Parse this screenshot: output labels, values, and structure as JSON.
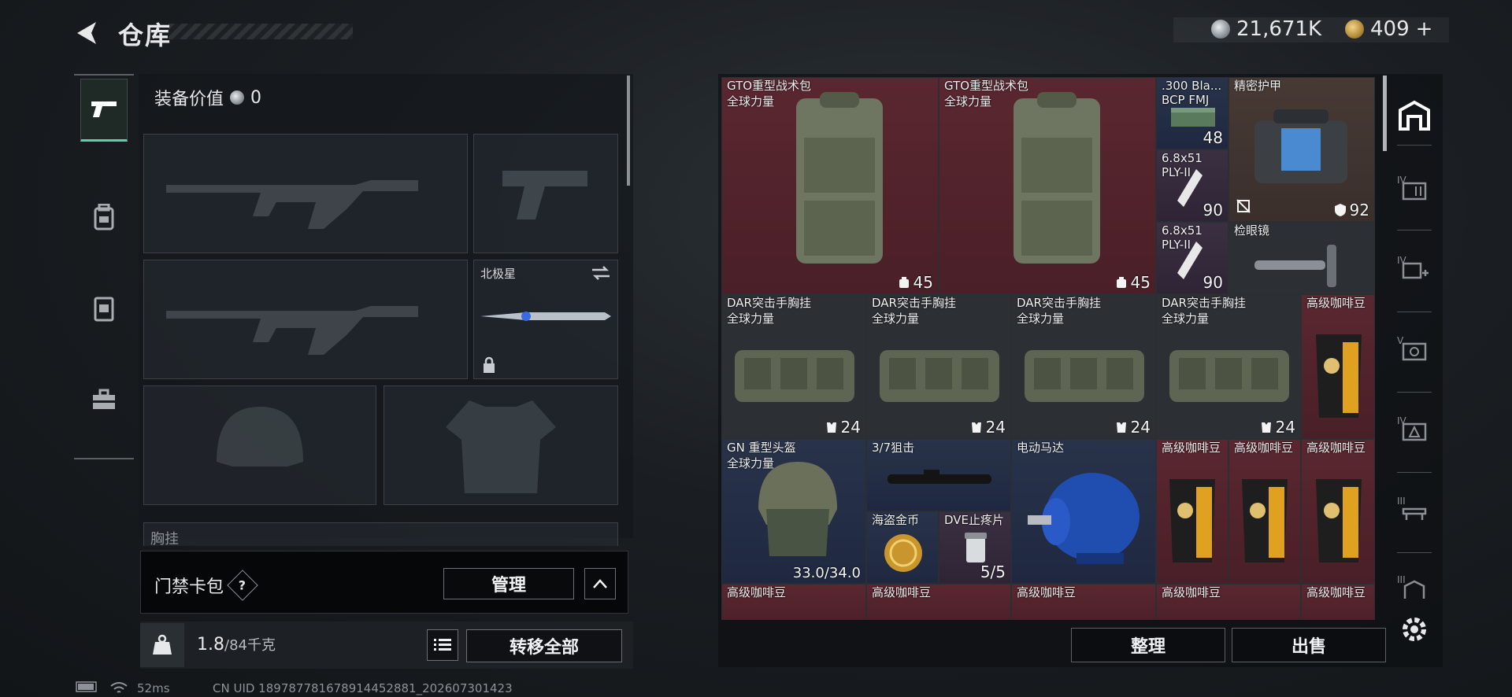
{
  "header": {
    "title": "仓库",
    "currency": [
      {
        "icon": "silver-coin-icon",
        "value": "21,671K"
      },
      {
        "icon": "gold-coin-icon",
        "value": "409",
        "plus": "+"
      }
    ]
  },
  "equipment": {
    "value_label": "装备价值",
    "value": "0",
    "melee_name": "北极星",
    "chest_label": "胸挂",
    "gatecard_label": "门禁卡包",
    "gatecard_help": "?",
    "manage_label": "管理",
    "weight_current": "1.8",
    "weight_max": "/84千克",
    "transfer_all_label": "转移全部"
  },
  "inventory": {
    "items": [
      {
        "name": "GTO重型战术包",
        "sub": "全球力量",
        "count": "45"
      },
      {
        "name": "GTO重型战术包",
        "sub": "全球力量",
        "count": "45"
      },
      {
        "name": ".300 Bla...",
        "sub": "BCP FMJ",
        "count": "48"
      },
      {
        "name": "精密护甲",
        "count_left": "",
        "count": "92"
      },
      {
        "name": "6.8x51",
        "sub": "PLY-II",
        "count": "90"
      },
      {
        "name": "6.8x51",
        "sub": "PLY-II",
        "count": "90"
      },
      {
        "name": "检眼镜"
      },
      {
        "name": "DAR突击手胸挂",
        "sub": "全球力量",
        "count": "24"
      },
      {
        "name": "DAR突击手胸挂",
        "sub": "全球力量",
        "count": "24"
      },
      {
        "name": "DAR突击手胸挂",
        "sub": "全球力量",
        "count": "24"
      },
      {
        "name": "DAR突击手胸挂",
        "sub": "全球力量",
        "count": "24"
      },
      {
        "name": "高级咖啡豆"
      },
      {
        "name": "GN 重型头盔",
        "sub": "全球力量",
        "count": "33.0/34.0"
      },
      {
        "name": "3/7狙击"
      },
      {
        "name": "电动马达"
      },
      {
        "name": "高级咖啡豆"
      },
      {
        "name": "高级咖啡豆"
      },
      {
        "name": "高级咖啡豆"
      },
      {
        "name": "海盗金币"
      },
      {
        "name": "DVE止疼片",
        "count": "5/5"
      },
      {
        "name": "高级咖啡豆"
      },
      {
        "name": "高级咖啡豆"
      },
      {
        "name": "高级咖啡豆"
      },
      {
        "name": "高级咖啡豆"
      },
      {
        "name": "高级咖啡豆"
      }
    ],
    "sort_label": "整理",
    "sell_label": "出售"
  },
  "right_rail": {
    "tiers": [
      "IV",
      "IV",
      "V",
      "IV",
      "III",
      "III"
    ]
  },
  "status": {
    "ping": "52ms",
    "uid": "CN UID 1897877816789144528​81_202607301423"
  },
  "colors": {
    "accent": "#4fd6a6",
    "red_rarity": "#5a2730",
    "blue_rarity": "#28334a",
    "purple_rarity": "#3b3042"
  }
}
